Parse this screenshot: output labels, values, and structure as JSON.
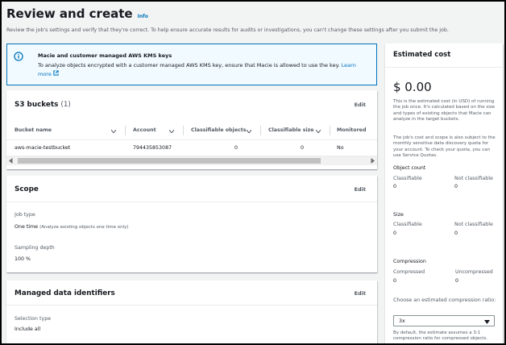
{
  "page": {
    "title": "Review and create",
    "info_label": "Info",
    "subtitle": "Review the job's settings and verify that they're correct. To help ensure accurate results for audits or investigations, you can't change these settings after you submit the job."
  },
  "alert": {
    "title": "Macie and customer managed AWS KMS keys",
    "body": "To analyze objects encrypted with a customer managed AWS KMS key, ensure that Macie is allowed to use the key.",
    "link_label": "Learn more",
    "accent_color": "#0073bb"
  },
  "s3_buckets": {
    "title": "S3 buckets",
    "count": "(1)",
    "edit_label": "Edit",
    "columns": [
      "Bucket name",
      "Account",
      "Classifiable objects",
      "Classifiable size",
      "Monitored"
    ],
    "rows": [
      [
        "aws-macie-testbucket",
        "794435853087",
        "0",
        "0",
        "No"
      ]
    ]
  },
  "scope": {
    "title": "Scope",
    "edit_label": "Edit",
    "job_type_label": "Job type",
    "job_type_value": "One time",
    "job_type_note": "(Analyze existing objects one time only)",
    "sampling_label": "Sampling depth",
    "sampling_value": "100 %"
  },
  "managed_identifiers": {
    "title": "Managed data identifiers",
    "edit_label": "Edit",
    "selection_label": "Selection type",
    "selection_value": "Include all"
  },
  "estimated_cost": {
    "title": "Estimated cost",
    "amount": "$ 0.00",
    "description": "This is the estimated cost (in USD) of running the job once. It's calculated based on the size and types of existing objects that Macie can analyze in the target buckets.",
    "quota_note": "The job's cost and scope is also subject to the monthly sensitive data discovery quota for your account. To check your quota, you can use Service Quotas.",
    "object_count": {
      "label": "Object count",
      "classifiable_label": "Classifiable",
      "classifiable_value": "0",
      "not_classifiable_label": "Not classifiable",
      "not_classifiable_value": "0"
    },
    "size": {
      "label": "Size",
      "classifiable_label": "Classifiable",
      "classifiable_value": "0",
      "not_classifiable_label": "Not classifiable",
      "not_classifiable_value": "0"
    },
    "compression": {
      "label": "Compression",
      "compressed_label": "Compressed",
      "compressed_value": "0",
      "uncompressed_label": "Uncompressed",
      "uncompressed_value": "0"
    },
    "ratio_label": "Choose an estimated compression ratio:",
    "ratio_value": "3x",
    "ratio_note": "By default, the estimate assumes a 3:1 compression ratio for compressed objects."
  },
  "icons": [
    "info-circle-icon",
    "external-link-icon",
    "sort-icon",
    "scroll-left-icon",
    "scroll-right-icon",
    "caret-down-icon"
  ]
}
